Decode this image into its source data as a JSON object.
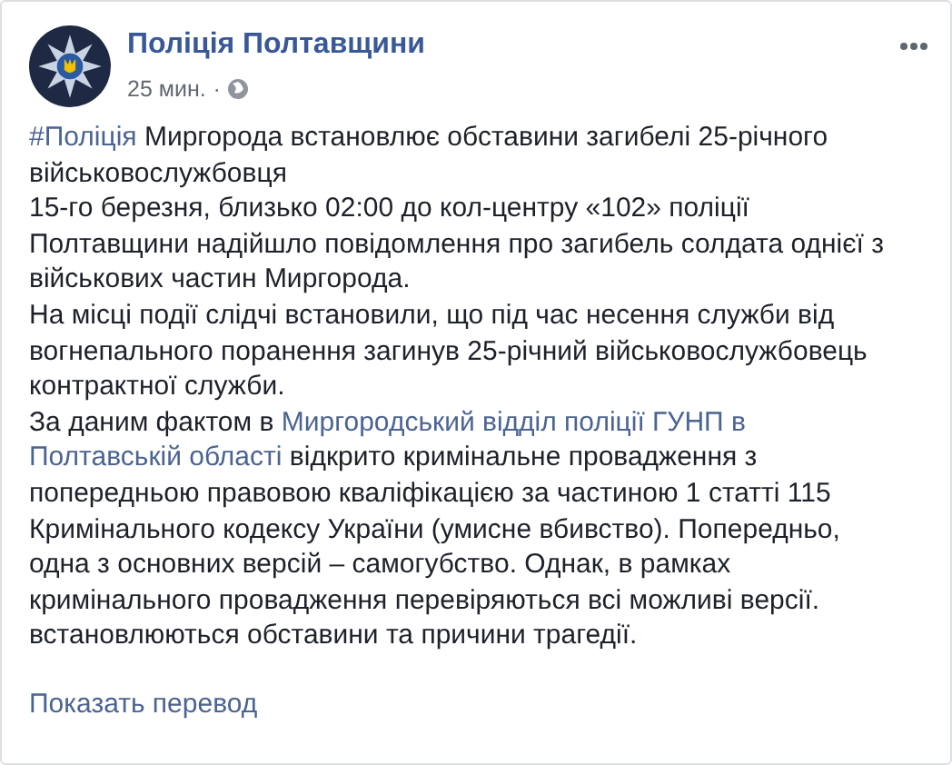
{
  "post": {
    "author": "Поліція Полтавщини",
    "time": "25 мин.",
    "separator": "·",
    "lines": [
      [
        {
          "text": "#Поліція",
          "link": true
        },
        {
          "text": " Миргорода встановлює обставини загибелі 25-річного",
          "link": false
        }
      ],
      [
        {
          "text": "військовослужбовця",
          "link": false
        }
      ],
      [
        {
          "text": "15-го березня, близько 02:00 до кол-центру «102» поліції",
          "link": false
        }
      ],
      [
        {
          "text": "Полтавщини надійшло повідомлення про загибель солдата однієї з",
          "link": false
        }
      ],
      [
        {
          "text": "військових частин Миргорода.",
          "link": false
        }
      ],
      [
        {
          "text": "На місці події слідчі встановили, що під час несення служби від",
          "link": false
        }
      ],
      [
        {
          "text": "вогнепального поранення загинув 25-річний військовослужбовець",
          "link": false
        }
      ],
      [
        {
          "text": "контрактної служби.",
          "link": false
        }
      ],
      [
        {
          "text": "За даним фактом в ",
          "link": false
        },
        {
          "text": "Миргородський відділ поліції ГУНП в",
          "link": true
        }
      ],
      [
        {
          "text": "Полтавській області",
          "link": true
        },
        {
          "text": " відкрито кримінальне провадження з",
          "link": false
        }
      ],
      [
        {
          "text": "попередньою правовою кваліфікацією за частиною 1 статті 115",
          "link": false
        }
      ],
      [
        {
          "text": "Кримінального кодексу України (умисне вбивство). Попередньо,",
          "link": false
        }
      ],
      [
        {
          "text": "одна з основних версій – самогубство. Однак, в рамках",
          "link": false
        }
      ],
      [
        {
          "text": "кримінального провадження перевіряються всі можливі версії.",
          "link": false
        }
      ],
      [
        {
          "text": "встановлюються обставини та причини трагедії.",
          "link": false
        }
      ]
    ],
    "translate_link": "Показать перевод"
  }
}
